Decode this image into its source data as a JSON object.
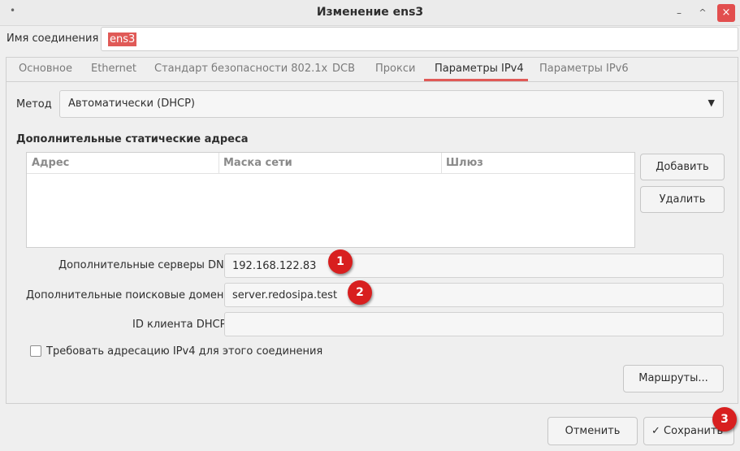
{
  "window": {
    "title": "Изменение ens3",
    "menu_icon": "dot-menu-icon",
    "controls": {
      "minimize": "–",
      "maximize": "^",
      "close": "×"
    },
    "accent_color": "#e05a57",
    "close_color": "#e24e4e"
  },
  "connection": {
    "label": "Имя соединения",
    "value": "ens3"
  },
  "tabs": [
    {
      "label": "Основное"
    },
    {
      "label": "Ethernet"
    },
    {
      "label": "Стандарт безопасности 802.1x"
    },
    {
      "label": "DCB"
    },
    {
      "label": "Прокси"
    },
    {
      "label": "Параметры IPv4"
    },
    {
      "label": "Параметры IPv6"
    }
  ],
  "active_tab": "Параметры IPv4",
  "method": {
    "label": "Метод",
    "value": "Автоматически (DHCP)"
  },
  "static_addresses": {
    "title": "Дополнительные статические адреса",
    "columns": [
      "Адрес",
      "Маска сети",
      "Шлюз"
    ],
    "rows": [],
    "add_button": "Добавить",
    "delete_button": "Удалить"
  },
  "dns": {
    "label": "Дополнительные серверы DNS",
    "value": "192.168.122.83"
  },
  "search_domains": {
    "label": "Дополнительные поисковые домены",
    "value": "server.redosipa.test"
  },
  "dhcp_client_id": {
    "label": "ID клиента DHCP",
    "value": ""
  },
  "require_ipv4": {
    "label": "Требовать адресацию IPv4 для этого соединения",
    "checked": false
  },
  "routes_button": "Маршруты...",
  "footer": {
    "cancel": "Отменить",
    "save": "Сохранить",
    "check_mark": "✓"
  },
  "annotations": [
    "1",
    "2",
    "3"
  ]
}
